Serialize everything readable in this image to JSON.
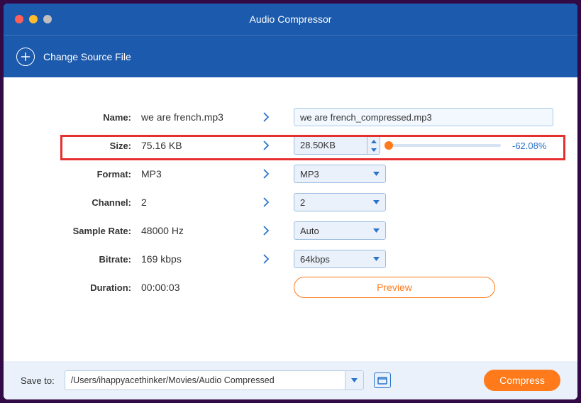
{
  "window": {
    "title": "Audio Compressor"
  },
  "toolbar": {
    "change_source_label": "Change Source File"
  },
  "fields": {
    "name": {
      "label": "Name:",
      "orig": "we are french.mp3",
      "target": "we are french_compressed.mp3"
    },
    "size": {
      "label": "Size:",
      "orig": "75.16 KB",
      "target": "28.50KB",
      "percent": "-62.08%"
    },
    "format": {
      "label": "Format:",
      "orig": "MP3",
      "target": "MP3"
    },
    "channel": {
      "label": "Channel:",
      "orig": "2",
      "target": "2"
    },
    "sample_rate": {
      "label": "Sample Rate:",
      "orig": "48000 Hz",
      "target": "Auto"
    },
    "bitrate": {
      "label": "Bitrate:",
      "orig": "169 kbps",
      "target": "64kbps"
    },
    "duration": {
      "label": "Duration:",
      "orig": "00:00:03"
    }
  },
  "preview_label": "Preview",
  "footer": {
    "save_to_label": "Save to:",
    "path": "/Users/ihappyacethinker/Movies/Audio Compressed",
    "compress_label": "Compress"
  }
}
